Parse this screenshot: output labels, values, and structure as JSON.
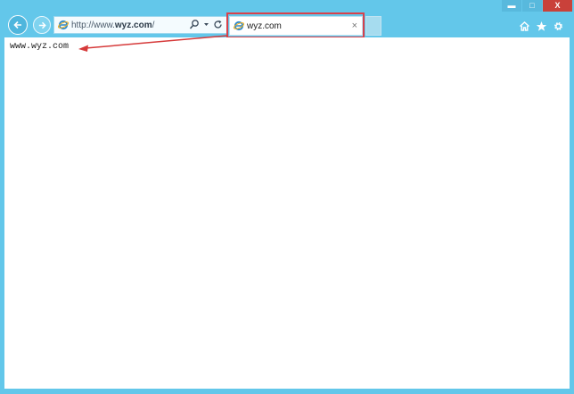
{
  "browser": {
    "address_bar": {
      "url_prefix": "http://www.",
      "url_domain": "wyz.com",
      "url_suffix": "/",
      "search_icon": "search-icon",
      "refresh_icon": "refresh-icon"
    },
    "tab": {
      "title": "wyz.com",
      "close_glyph": "×"
    },
    "window_controls": {
      "minimize": "▬",
      "maximize": "□",
      "close": "X"
    },
    "colors": {
      "frame": "#63c7ea",
      "highlight": "#d9414b",
      "close_button": "#c9413a"
    }
  },
  "page": {
    "body_text": "www.wyz.com"
  }
}
